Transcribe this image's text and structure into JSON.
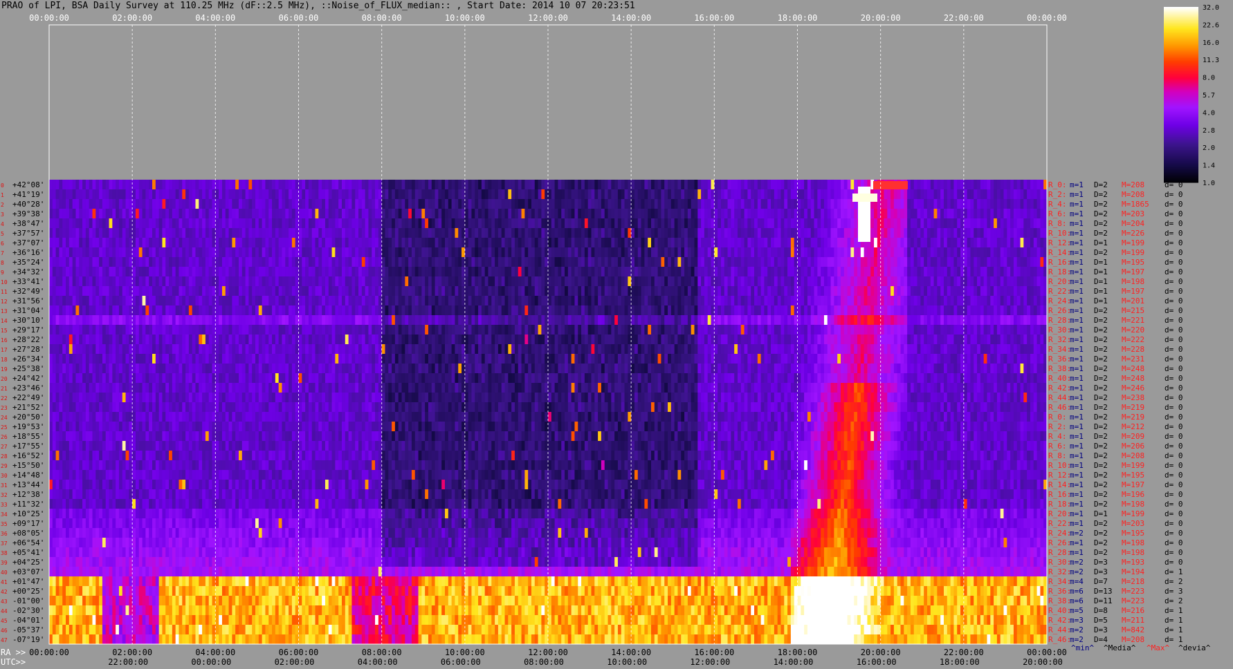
{
  "title": "PRAO of LPI, BSA Daily Survey at 110.25 MHz (dF::2.5 MHz), ::Noise_of_FLUX_median:: , Start Date: 2014 10 07 20:23:51",
  "chart_data": {
    "type": "heatmap",
    "top_time_ticks": [
      "00:00:00",
      "02:00:00",
      "04:00:00",
      "06:00:00",
      "08:00:00",
      "10:00:00",
      "12:00:00",
      "14:00:00",
      "16:00:00",
      "18:00:00",
      "20:00:00",
      "22:00:00",
      "00:00:00"
    ],
    "ra_ticks": [
      "00:00:00",
      "02:00:00",
      "04:00:00",
      "06:00:00",
      "08:00:00",
      "10:00:00",
      "12:00:00",
      "14:00:00",
      "16:00:00",
      "18:00:00",
      "20:00:00",
      "22:00:00",
      "00:00:00"
    ],
    "utc_ticks": [
      "22:00:00",
      "00:00:00",
      "02:00:00",
      "04:00:00",
      "06:00:00",
      "08:00:00",
      "10:00:00",
      "12:00:00",
      "14:00:00",
      "16:00:00",
      "18:00:00",
      "20:00:00"
    ],
    "ra_label": "RA >>",
    "utc_label": "UTC>>",
    "declinations": [
      "+42°08'",
      "+41°19'",
      "+40°28'",
      "+39°38'",
      "+38°47'",
      "+37°57'",
      "+37°07'",
      "+36°16'",
      "+35°24'",
      "+34°32'",
      "+33°41'",
      "+32°49'",
      "+31°56'",
      "+31°04'",
      "+30°10'",
      "+29°17'",
      "+28°22'",
      "+27°28'",
      "+26°34'",
      "+25°38'",
      "+24°42'",
      "+23°46'",
      "+22°49'",
      "+21°52'",
      "+20°50'",
      "+19°53'",
      "+18°55'",
      "+17°55'",
      "+16°52'",
      "+15°50'",
      "+14°48'",
      "+13°44'",
      "+12°38'",
      "+11°32'",
      "+10°25'",
      "+09°17'",
      "+08°05'",
      "+06°54'",
      "+05°41'",
      "+04°25'",
      "+03°07'",
      "+01°47'",
      "+00°25'",
      "-01°00'",
      "-02°30'",
      "-04°01'",
      "-05°37'",
      "-07°19'"
    ],
    "row_numbers": [
      "0",
      "1",
      "2",
      "3",
      "4",
      "5",
      "6",
      "7",
      "8",
      "9",
      "10",
      "11",
      "12",
      "13",
      "14",
      "15",
      "16",
      "17",
      "18",
      "19",
      "20",
      "21",
      "22",
      "23",
      "24",
      "25",
      "26",
      "27",
      "28",
      "29",
      "30",
      "31",
      "32",
      "33",
      "34",
      "35",
      "36",
      "37",
      "38",
      "39",
      "40",
      "41",
      "42",
      "43",
      "44",
      "45",
      "46",
      "47"
    ],
    "row_stats": [
      {
        "r": "R_0:",
        "m": "m=1",
        "D": "D=2",
        "M": "M=208",
        "d": "d= 0"
      },
      {
        "r": "R_2:",
        "m": "m=1",
        "D": "D=2",
        "M": "M=208",
        "d": "d= 0"
      },
      {
        "r": "R_4:",
        "m": "m=1",
        "D": "D=2",
        "M": "M=1865",
        "d": "d= 0"
      },
      {
        "r": "R_6:",
        "m": "m=1",
        "D": "D=2",
        "M": "M=203",
        "d": "d= 0"
      },
      {
        "r": "R_8:",
        "m": "m=1",
        "D": "D=2",
        "M": "M=204",
        "d": "d= 0"
      },
      {
        "r": "R_10:",
        "m": "m=1",
        "D": "D=2",
        "M": "M=226",
        "d": "d= 0"
      },
      {
        "r": "R_12:",
        "m": "m=1",
        "D": "D=1",
        "M": "M=199",
        "d": "d= 0"
      },
      {
        "r": "R_14:",
        "m": "m=1",
        "D": "D=2",
        "M": "M=199",
        "d": "d= 0"
      },
      {
        "r": "R_16:",
        "m": "m=1",
        "D": "D=1",
        "M": "M=195",
        "d": "d= 0"
      },
      {
        "r": "R_18:",
        "m": "m=1",
        "D": "D=1",
        "M": "M=197",
        "d": "d= 0"
      },
      {
        "r": "R_20:",
        "m": "m=1",
        "D": "D=1",
        "M": "M=198",
        "d": "d= 0"
      },
      {
        "r": "R_22:",
        "m": "m=1",
        "D": "D=1",
        "M": "M=197",
        "d": "d= 0"
      },
      {
        "r": "R_24:",
        "m": "m=1",
        "D": "D=1",
        "M": "M=201",
        "d": "d= 0"
      },
      {
        "r": "R_26:",
        "m": "m=1",
        "D": "D=2",
        "M": "M=215",
        "d": "d= 0"
      },
      {
        "r": "R_28:",
        "m": "m=1",
        "D": "D=2",
        "M": "M=221",
        "d": "d= 0"
      },
      {
        "r": "R_30:",
        "m": "m=1",
        "D": "D=2",
        "M": "M=220",
        "d": "d= 0"
      },
      {
        "r": "R_32:",
        "m": "m=1",
        "D": "D=2",
        "M": "M=222",
        "d": "d= 0"
      },
      {
        "r": "R_34:",
        "m": "m=1",
        "D": "D=2",
        "M": "M=228",
        "d": "d= 0"
      },
      {
        "r": "R_36:",
        "m": "m=1",
        "D": "D=2",
        "M": "M=231",
        "d": "d= 0"
      },
      {
        "r": "R_38:",
        "m": "m=1",
        "D": "D=2",
        "M": "M=248",
        "d": "d= 0"
      },
      {
        "r": "R_40:",
        "m": "m=1",
        "D": "D=2",
        "M": "M=248",
        "d": "d= 0"
      },
      {
        "r": "R_42:",
        "m": "m=1",
        "D": "D=2",
        "M": "M=246",
        "d": "d= 0"
      },
      {
        "r": "R_44:",
        "m": "m=1",
        "D": "D=2",
        "M": "M=238",
        "d": "d= 0"
      },
      {
        "r": "R_46:",
        "m": "m=1",
        "D": "D=2",
        "M": "M=219",
        "d": "d= 0"
      },
      {
        "r": "R_0:",
        "m": "m=1",
        "D": "D=2",
        "M": "M=219",
        "d": "d= 0"
      },
      {
        "r": "R_2:",
        "m": "m=1",
        "D": "D=2",
        "M": "M=212",
        "d": "d= 0"
      },
      {
        "r": "R_4:",
        "m": "m=1",
        "D": "D=2",
        "M": "M=209",
        "d": "d= 0"
      },
      {
        "r": "R_6:",
        "m": "m=1",
        "D": "D=2",
        "M": "M=206",
        "d": "d= 0"
      },
      {
        "r": "R_8:",
        "m": "m=1",
        "D": "D=2",
        "M": "M=208",
        "d": "d= 0"
      },
      {
        "r": "R_10:",
        "m": "m=1",
        "D": "D=2",
        "M": "M=199",
        "d": "d= 0"
      },
      {
        "r": "R_12:",
        "m": "m=1",
        "D": "D=2",
        "M": "M=195",
        "d": "d= 0"
      },
      {
        "r": "R_14:",
        "m": "m=1",
        "D": "D=2",
        "M": "M=197",
        "d": "d= 0"
      },
      {
        "r": "R_16:",
        "m": "m=1",
        "D": "D=2",
        "M": "M=196",
        "d": "d= 0"
      },
      {
        "r": "R_18:",
        "m": "m=1",
        "D": "D=2",
        "M": "M=198",
        "d": "d= 0"
      },
      {
        "r": "R_20:",
        "m": "m=1",
        "D": "D=1",
        "M": "M=199",
        "d": "d= 0"
      },
      {
        "r": "R_22:",
        "m": "m=1",
        "D": "D=2",
        "M": "M=203",
        "d": "d= 0"
      },
      {
        "r": "R_24:",
        "m": "m=2",
        "D": "D=2",
        "M": "M=195",
        "d": "d= 0"
      },
      {
        "r": "R_26:",
        "m": "m=1",
        "D": "D=2",
        "M": "M=198",
        "d": "d= 0"
      },
      {
        "r": "R_28:",
        "m": "m=1",
        "D": "D=2",
        "M": "M=198",
        "d": "d= 0"
      },
      {
        "r": "R_30:",
        "m": "m=2",
        "D": "D=3",
        "M": "M=193",
        "d": "d= 0"
      },
      {
        "r": "R_32:",
        "m": "m=2",
        "D": "D=3",
        "M": "M=194",
        "d": "d= 1"
      },
      {
        "r": "R_34:",
        "m": "m=4",
        "D": "D=7",
        "M": "M=218",
        "d": "d= 2"
      },
      {
        "r": "R_36:",
        "m": "m=6",
        "D": "D=13",
        "M": "M=223",
        "d": "d= 3"
      },
      {
        "r": "R_38:",
        "m": "m=6",
        "D": "D=11",
        "M": "M=223",
        "d": "d= 2"
      },
      {
        "r": "R_40:",
        "m": "m=5",
        "D": "D=8",
        "M": "M=216",
        "d": "d= 1"
      },
      {
        "r": "R_42:",
        "m": "m=3",
        "D": "D=5",
        "M": "M=211",
        "d": "d= 1"
      },
      {
        "r": "R_44:",
        "m": "m=2",
        "D": "D=3",
        "M": "M=842",
        "d": "d= 1"
      },
      {
        "r": "R_46:",
        "m": "m=2",
        "D": "D=4",
        "M": "M=208",
        "d": "d= 1"
      }
    ],
    "stats_footer": {
      "min": "^min^",
      "median": "^Media^",
      "max": "^Max^",
      "devia": "^devia^"
    },
    "colorbar": {
      "ticks": [
        "32.0",
        "22.6",
        "16.0",
        "11.3",
        "8.0",
        "5.7",
        "4.0",
        "2.8",
        "2.0",
        "1.4",
        "1.0"
      ],
      "log_scale": true,
      "range": [
        1.0,
        32.0
      ]
    },
    "colors": {
      "background": "#9a9a9a",
      "stat_red": "#ff2020",
      "stat_blue": "#000080",
      "row_number_red": "#e01010"
    }
  }
}
